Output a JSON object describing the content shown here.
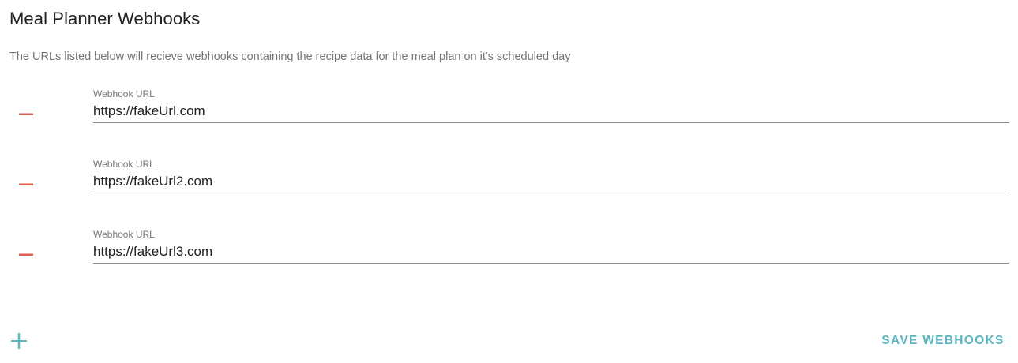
{
  "header": {
    "title": "Meal Planner Webhooks",
    "description": "The URLs listed below will recieve webhooks containing the recipe data for the meal plan on it's scheduled day"
  },
  "webhooks": [
    {
      "label": "Webhook URL",
      "value": "https://fakeUrl.com"
    },
    {
      "label": "Webhook URL",
      "value": "https://fakeUrl2.com"
    },
    {
      "label": "Webhook URL",
      "value": "https://fakeUrl3.com"
    }
  ],
  "actions": {
    "add_icon": "plus-icon",
    "remove_icon": "minus-icon",
    "save_label": "SAVE WEBHOOKS"
  },
  "colors": {
    "remove": "#e05a4e",
    "accent": "#5bb6c1",
    "text": "#212121",
    "muted": "#757575"
  }
}
